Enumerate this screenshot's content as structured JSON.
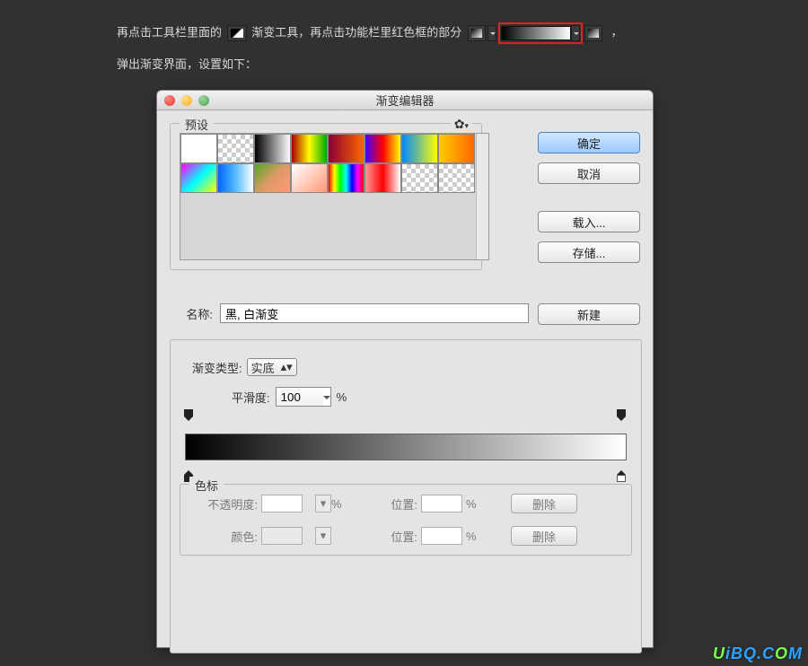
{
  "instructions": {
    "line1a": "再点击工具栏里面的",
    "line1b": "渐变工具，再点击功能栏里红色框的部分",
    "line1c": "，",
    "line2": "弹出渐变界面，设置如下："
  },
  "dialog": {
    "title": "渐变编辑器",
    "preset_legend": "预设",
    "buttons": {
      "ok": "确定",
      "cancel": "取消",
      "load": "载入...",
      "save": "存储...",
      "new": "新建"
    },
    "name_label": "名称:",
    "name_value": "黑, 白渐变",
    "grad_type_label": "渐变类型:",
    "grad_type_value": "实底",
    "smoothness_label": "平滑度:",
    "smoothness_value": "100",
    "pct": "%",
    "stops_legend": "色标",
    "opacity_label": "不透明度:",
    "color_label": "颜色:",
    "position_label": "位置:",
    "delete_label": "删除"
  },
  "swatches": [
    "linear-gradient(90deg,#fff,#fff)",
    "checker",
    "linear-gradient(90deg,#000,#fff)",
    "linear-gradient(90deg,#a00,#ff0,#0a0)",
    "linear-gradient(90deg,#803,#f60)",
    "linear-gradient(90deg,#40f,#f00,#ff0)",
    "linear-gradient(90deg,#08f,#ff0)",
    "linear-gradient(90deg,#fc0,#f60)",
    "linear-gradient(135deg,#f0f,#0ff,#ff0)",
    "linear-gradient(90deg,#06f,#5bf,#fff)",
    "linear-gradient(135deg,#5a2,#d96,#f97)",
    "linear-gradient(135deg,#fff,#f97)",
    "linear-gradient(90deg,#f00,#ff0,#0f0,#0ff,#00f,#f0f,#f00)",
    "linear-gradient(90deg,#f99,#f00,#fff)",
    "checker",
    "checker"
  ],
  "watermark": {
    "a": "U",
    "b": "iBQ.C",
    "c": "O",
    "d": "M"
  }
}
